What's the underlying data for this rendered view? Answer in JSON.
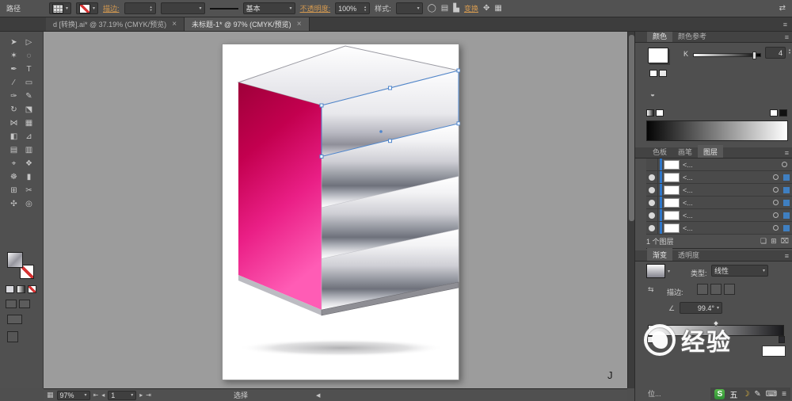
{
  "control_bar": {
    "path_label": "路径",
    "stroke_label": "描边:",
    "brush_value": "基本",
    "opacity_label": "不透明度:",
    "opacity_value": "100%",
    "style_label": "样式:",
    "transform_link": "变换"
  },
  "tabs": {
    "items": [
      {
        "label": "d [转换].ai* @ 37.19% (CMYK/预览)",
        "close": "×"
      },
      {
        "label": "未标题-1* @ 97% (CMYK/预览)",
        "close": "×"
      }
    ]
  },
  "toolbar": {
    "tools": [
      {
        "name": "selection",
        "glyph": "➤"
      },
      {
        "name": "direct-selection",
        "glyph": "▷"
      },
      {
        "name": "magic-wand",
        "glyph": "✶"
      },
      {
        "name": "lasso",
        "glyph": "◌"
      },
      {
        "name": "pen",
        "glyph": "✒"
      },
      {
        "name": "type",
        "glyph": "T"
      },
      {
        "name": "line-segment",
        "glyph": "∕"
      },
      {
        "name": "rectangle",
        "glyph": "▭"
      },
      {
        "name": "paintbrush",
        "glyph": "✑"
      },
      {
        "name": "pencil",
        "glyph": "✎"
      },
      {
        "name": "rotate",
        "glyph": "↻"
      },
      {
        "name": "scale",
        "glyph": "⬔"
      },
      {
        "name": "width",
        "glyph": "⋈"
      },
      {
        "name": "free-transform",
        "glyph": "▦"
      },
      {
        "name": "shape-builder",
        "glyph": "◧"
      },
      {
        "name": "perspective-grid",
        "glyph": "⊿"
      },
      {
        "name": "mesh",
        "glyph": "▤"
      },
      {
        "name": "gradient",
        "glyph": "▥"
      },
      {
        "name": "eyedropper",
        "glyph": "⌖"
      },
      {
        "name": "blend",
        "glyph": "❖"
      },
      {
        "name": "symbol-sprayer",
        "glyph": "☸"
      },
      {
        "name": "column-graph",
        "glyph": "▮"
      },
      {
        "name": "artboard",
        "glyph": "⊞"
      },
      {
        "name": "slice",
        "glyph": "✂"
      },
      {
        "name": "hand",
        "glyph": "✣"
      },
      {
        "name": "zoom",
        "glyph": "◎"
      }
    ]
  },
  "canvas": {
    "stray_text": "J"
  },
  "status_bar": {
    "zoom_value": "97%",
    "artboard_value": "1",
    "status_text": "选择"
  },
  "right_panel": {
    "color": {
      "tabs": [
        "颜色",
        "颜色参考"
      ],
      "channel_label": "K",
      "channel_value": "4"
    },
    "panel_tabs2": [
      "色板",
      "画笔",
      "图层"
    ],
    "layers": {
      "rows": [
        {
          "label": "<..."
        },
        {
          "label": "<..."
        },
        {
          "label": "<..."
        },
        {
          "label": "<..."
        },
        {
          "label": "<..."
        },
        {
          "label": "<..."
        }
      ],
      "footer_text": "1 个图层"
    },
    "panel_tabs3": [
      "渐变",
      "透明度"
    ],
    "gradient": {
      "type_label": "类型:",
      "type_value": "线性",
      "stroke_label": "描边:",
      "angle_value": "99.4°",
      "location_label": "位..."
    }
  },
  "watermark": {
    "text": "经验"
  },
  "ime": {
    "logo": "S",
    "wubi": "五",
    "moon": "☽",
    "pen": "✎",
    "keyboard": "⌨",
    "menu": "≡"
  },
  "icons": {
    "chevron_down": "▾",
    "menu": "≡",
    "spin_up": "▲",
    "spin_down": "▼",
    "nav_first": "⇤",
    "nav_prev": "◂",
    "nav_next": "▸",
    "nav_last": "⇥",
    "scroll_left": "◀",
    "workspace_swap": "⇄",
    "circle": "◯",
    "document": "▤",
    "align": "▙",
    "transform_grid": "✥",
    "pattern": "▦",
    "reverse": "⇆",
    "angle": "∠",
    "new_group": "❏",
    "new_layer": "⊞",
    "delete": "⌧",
    "bucket": "◒"
  },
  "colors": {
    "accent_blue": "#3f7fc1",
    "magenta_top": "#9e0039",
    "magenta_bottom": "#ff5cb5",
    "canvas_gray": "#9c9c9c"
  }
}
